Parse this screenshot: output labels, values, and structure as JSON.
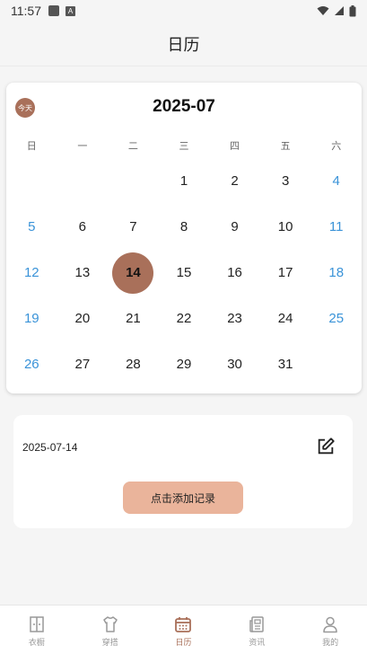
{
  "status_bar": {
    "time": "11:57",
    "a_badge": "A"
  },
  "header": {
    "title": "日历"
  },
  "calendar": {
    "today_label": "今天",
    "month_title": "2025-07",
    "weekdays": [
      "日",
      "一",
      "二",
      "三",
      "四",
      "五",
      "六"
    ],
    "days": [
      "",
      "",
      "",
      "1",
      "2",
      "3",
      "4",
      "5",
      "6",
      "7",
      "8",
      "9",
      "10",
      "11",
      "12",
      "13",
      "14",
      "15",
      "16",
      "17",
      "18",
      "19",
      "20",
      "21",
      "22",
      "23",
      "24",
      "25",
      "26",
      "27",
      "28",
      "29",
      "30",
      "31",
      "",
      ""
    ],
    "selected_day": "14",
    "colors": {
      "accent": "#a9705a",
      "weekend": "#3a93d8"
    }
  },
  "record": {
    "selected_date": "2025-07-14",
    "add_button": "点击添加记录",
    "colors": {
      "button": "#eab49b"
    }
  },
  "tabbar": {
    "items": [
      {
        "label": "衣橱",
        "icon": "wardrobe-icon"
      },
      {
        "label": "穿搭",
        "icon": "shirt-icon"
      },
      {
        "label": "日历",
        "icon": "calendar-icon",
        "active": true
      },
      {
        "label": "资讯",
        "icon": "news-icon"
      },
      {
        "label": "我的",
        "icon": "person-icon"
      }
    ]
  }
}
